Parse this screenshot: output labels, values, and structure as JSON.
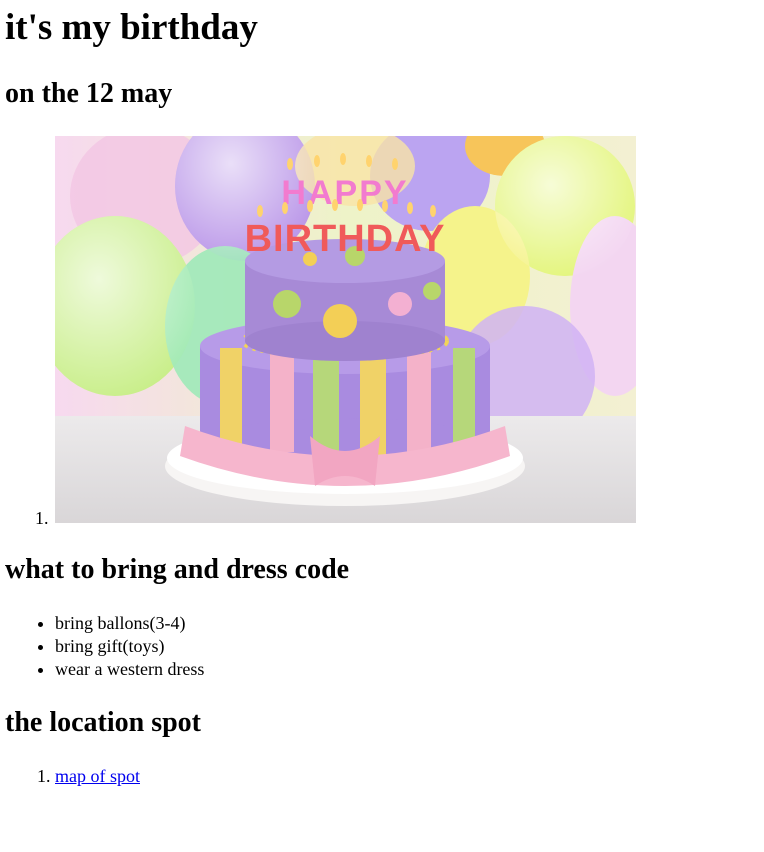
{
  "page": {
    "title": "it's my birthday",
    "subtitle": "on the 12 may"
  },
  "cake_list": {
    "marker": "1.",
    "image_text": "HAPPY BIRTHDAY"
  },
  "bring": {
    "heading": "what to bring and dress code",
    "items": [
      "bring ballons(3-4)",
      "bring gift(toys)",
      "wear a western dress"
    ]
  },
  "location": {
    "heading": "the location spot",
    "link_text": "map of spot"
  },
  "colors": {
    "link": "#0000ee",
    "text": "#000000"
  }
}
